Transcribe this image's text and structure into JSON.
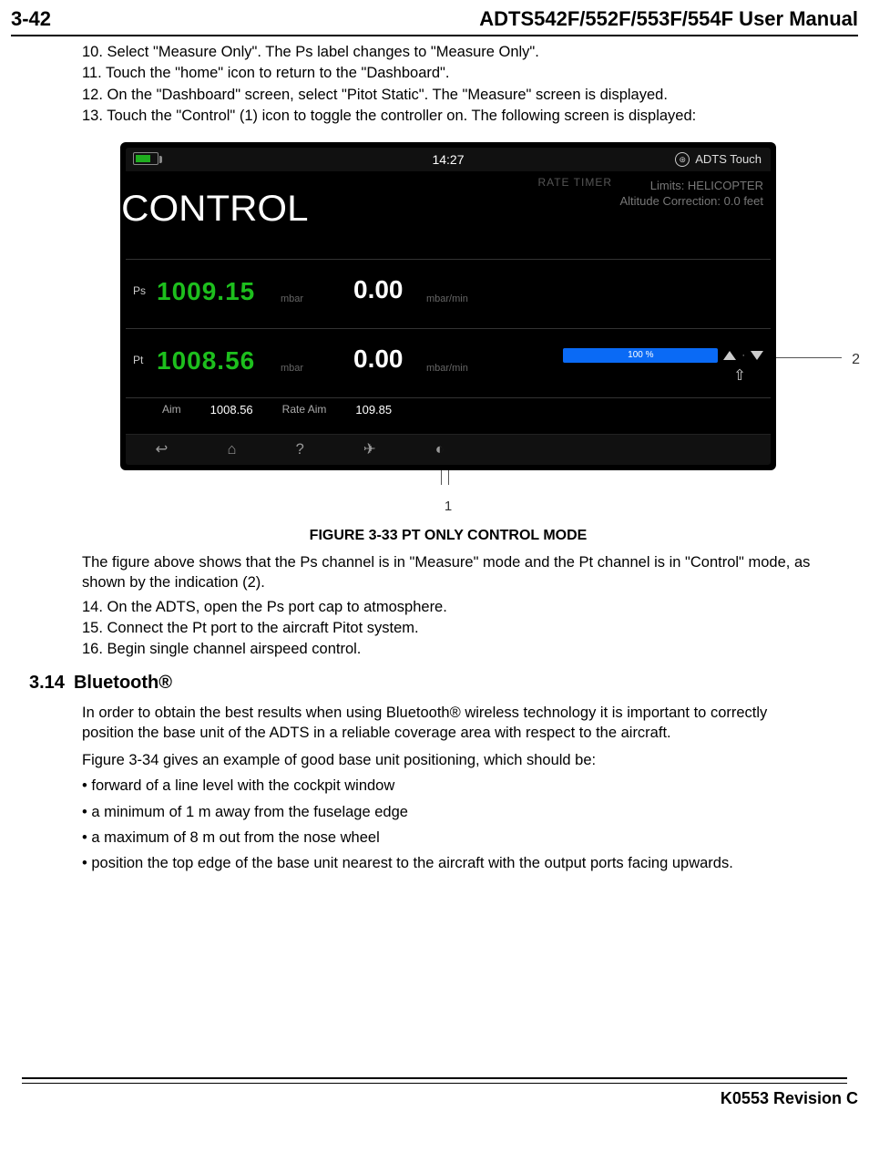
{
  "header": {
    "page_num": "3-42",
    "manual_title": "ADTS542F/552F/553F/554F User Manual"
  },
  "steps_top": [
    "10. Select \"Measure Only\". The Ps label changes to \"Measure Only\".",
    "11. Touch the \"home\" icon to return to the \"Dashboard\".",
    "12. On the \"Dashboard\" screen, select \"Pitot Static\". The \"Measure\" screen is displayed.",
    "13. Touch the \"Control\" (1) icon to toggle the controller on. The following screen is displayed:"
  ],
  "device": {
    "clock": "14:27",
    "brand": "ADTS Touch",
    "rate_timer": "RATE TIMER",
    "limits_line1": "Limits: HELICOPTER",
    "limits_line2": "Altitude Correction: 0.0 feet",
    "control_label": "CONTROL",
    "ps": {
      "label": "Ps",
      "value": "1009.15",
      "unit": "mbar",
      "rate": "0.00",
      "rate_unit": "mbar/min"
    },
    "pt": {
      "label": "Pt",
      "value": "1008.56",
      "unit": "mbar",
      "rate": "0.00",
      "rate_unit": "mbar/min"
    },
    "aim": {
      "aim_label": "Aim",
      "aim_value": "1008.56",
      "rate_aim_label": "Rate Aim",
      "rate_aim_value": "109.85"
    },
    "progress": "100 %"
  },
  "callouts": {
    "one": "1",
    "two": "2"
  },
  "figure_caption": "FIGURE 3-33 PT ONLY CONTROL MODE",
  "after_figure_paras": [
    "The figure above shows that the Ps channel is in \"Measure\" mode and the Pt channel is in \"Control\" mode, as shown by the indication (2)."
  ],
  "steps_mid": [
    "14. On the ADTS, open the Ps port cap to atmosphere.",
    "15. Connect the Pt port to the aircraft Pitot system.",
    "16. Begin single channel airspeed control."
  ],
  "section": {
    "number": "3.14",
    "title": "Bluetooth®"
  },
  "bt_paras": [
    "In order to obtain the best results when using Bluetooth® wireless technology it is important to correctly position the base unit of the ADTS in a reliable coverage area with respect to the aircraft.",
    "Figure 3-34 gives an example of good base unit positioning, which should be:"
  ],
  "bullets": [
    "• forward of a line level with the cockpit window",
    "• a minimum of 1 m away from the fuselage edge",
    "• a maximum of 8 m out from the nose wheel",
    "• position the top edge of the base unit nearest to the aircraft with the output ports facing upwards."
  ],
  "footer": {
    "revision": "K0553 Revision C"
  }
}
